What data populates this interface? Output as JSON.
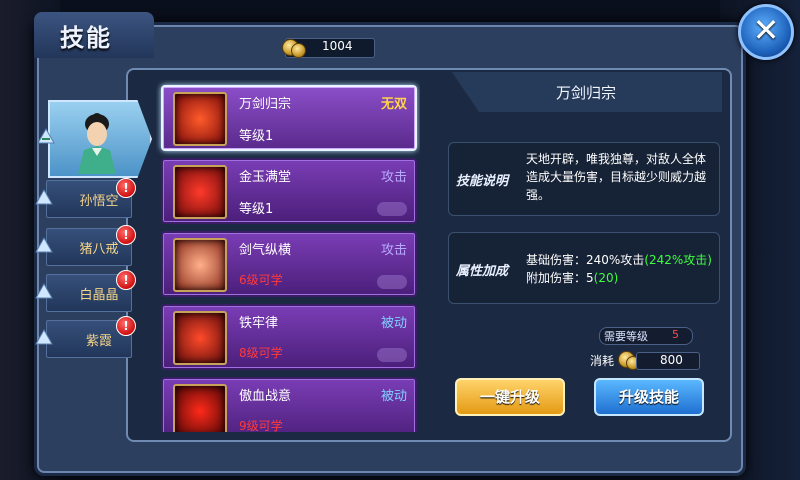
{
  "window": {
    "title": "技能",
    "close_icon": "close-x-icon"
  },
  "currency": {
    "icon": "coin-icon",
    "value": "1004"
  },
  "characters": [
    {
      "name": "",
      "selected": true,
      "icon": "character-portrait"
    },
    {
      "name": "孙悟空",
      "alert": "!"
    },
    {
      "name": "猪八戒",
      "alert": "!"
    },
    {
      "name": "白晶晶",
      "alert": "!"
    },
    {
      "name": "紫霞",
      "alert": "!"
    }
  ],
  "skills": [
    {
      "name": "万剑归宗",
      "type": "无双",
      "status": "等级1",
      "type_color": "#ffd24a",
      "selected": true
    },
    {
      "name": "金玉满堂",
      "type": "攻击",
      "status": "等级1",
      "type_color": "#b9a8ff"
    },
    {
      "name": "剑气纵横",
      "type": "攻击",
      "status": "6级可学",
      "type_color": "#b9a8ff",
      "locked": true
    },
    {
      "name": "铁牢律",
      "type": "被动",
      "status": "8级可学",
      "type_color": "#7fd0ff",
      "locked": true
    },
    {
      "name": "傲血战意",
      "type": "被动",
      "status": "9级可学",
      "type_color": "#7fd0ff",
      "locked": true
    }
  ],
  "detail": {
    "title": "万剑归宗",
    "desc_label": "技能说明",
    "desc_text": "天地开辟，唯我独尊，对敌人全体造成大量伤害，目标越少则威力越强。",
    "attr_label": "属性加成",
    "attr_line1_prefix": "基础伤害：240%攻击",
    "attr_line1_bonus": "(242%攻击)",
    "attr_line2_prefix": "附加伤害：5",
    "attr_line2_bonus": "(20)",
    "req_label": "需要等级",
    "req_value": "5",
    "cost_label": "消耗",
    "cost_value": "800",
    "btn_quick": "一键升级",
    "btn_upgrade": "升级技能"
  }
}
